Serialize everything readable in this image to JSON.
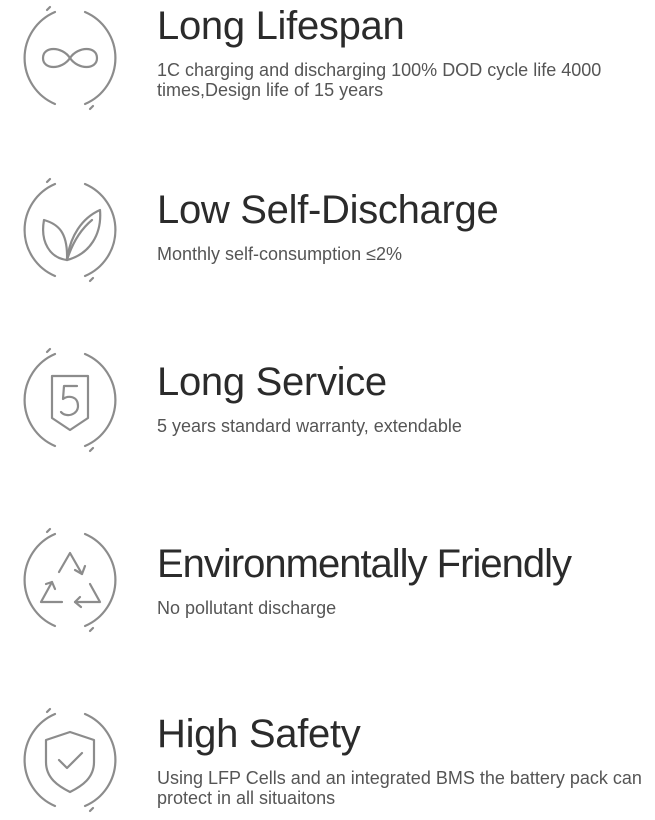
{
  "features": [
    {
      "icon": "infinity-icon",
      "title": "Long Lifespan",
      "description": "1C charging and discharging 100% DOD cycle life 4000 times,Design life of 15 years"
    },
    {
      "icon": "leaf-icon",
      "title": "Low Self-Discharge",
      "description": "Monthly self-consumption ≤2%"
    },
    {
      "icon": "shield-five-icon",
      "title": "Long Service",
      "description": "5 years standard warranty, extendable"
    },
    {
      "icon": "recycle-icon",
      "title": "Environmentally Friendly",
      "description": "No pollutant discharge"
    },
    {
      "icon": "shield-check-icon",
      "title": "High Safety",
      "description": "Using LFP Cells and an integrated BMS the battery pack can protect in all situaitons"
    }
  ],
  "colors": {
    "icon_stroke": "#8c8c8c",
    "title": "#2b2b2b",
    "description": "#555555"
  }
}
